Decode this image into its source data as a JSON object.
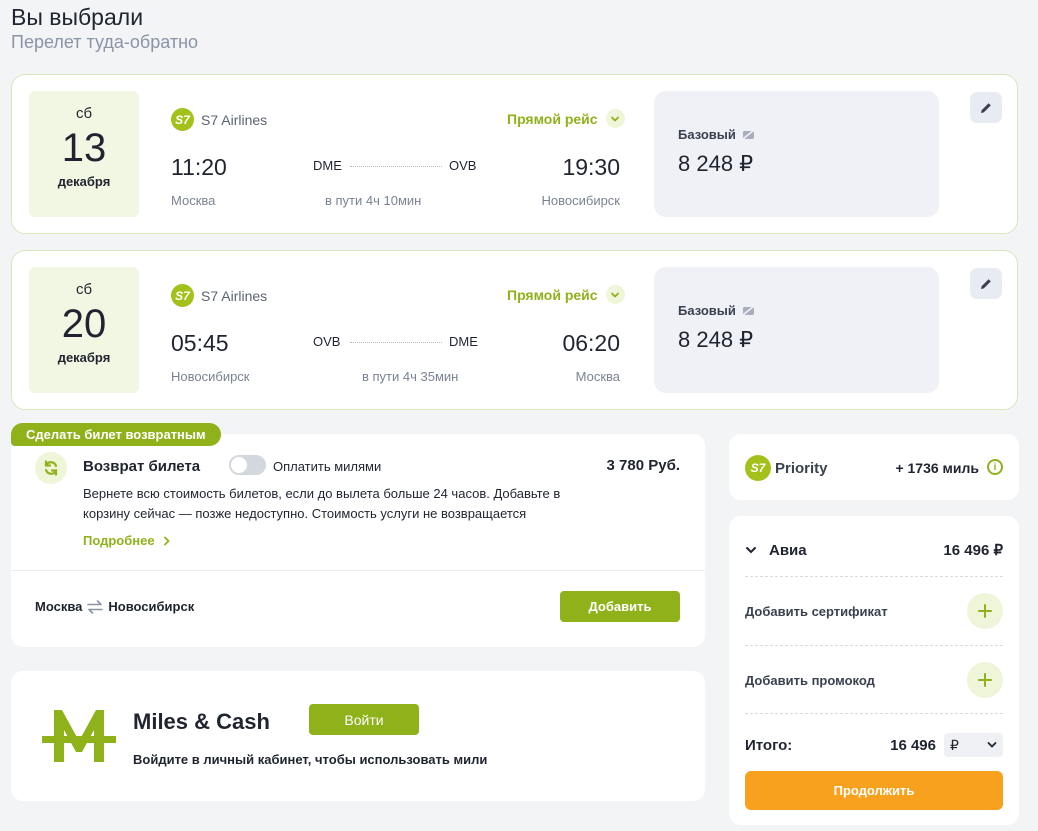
{
  "header": {
    "title": "Вы выбрали",
    "subtitle": "Перелет туда-обратно"
  },
  "flights": [
    {
      "weekday": "сб",
      "day": "13",
      "month": "декабря",
      "airline_logo": "S7",
      "airline": "S7 Airlines",
      "direct_label": "Прямой рейс",
      "dep_time": "11:20",
      "arr_time": "19:30",
      "from_code": "DME",
      "to_code": "OVB",
      "from_city": "Москва",
      "to_city": "Новосибирск",
      "duration": "в пути 4ч 10мин",
      "fare_name": "Базовый",
      "fare_price": "8 248 ₽"
    },
    {
      "weekday": "сб",
      "day": "20",
      "month": "декабря",
      "airline_logo": "S7",
      "airline": "S7 Airlines",
      "direct_label": "Прямой рейс",
      "dep_time": "05:45",
      "arr_time": "06:20",
      "from_code": "OVB",
      "to_code": "DME",
      "from_city": "Новосибирск",
      "to_city": "Москва",
      "duration": "в пути 4ч 35мин",
      "fare_name": "Базовый",
      "fare_price": "8 248 ₽"
    }
  ],
  "refund": {
    "tag": "Сделать билет возвратным",
    "title": "Возврат билета",
    "toggle_label": "Оплатить милями",
    "toggle_on": false,
    "price": "3 780 Руб.",
    "description": "Вернете всю стоимость билетов, если до вылета больше 24 часов. Добавьте в корзину сейчас — позже недоступно. Стоимость услуги не возвращается",
    "more_label": "Подробнее",
    "route_from": "Москва",
    "route_to": "Новосибирск",
    "add_label": "Добавить"
  },
  "miles_cash": {
    "title": "Miles & Cash",
    "login_label": "Войти",
    "subtitle": "Войдите в личный кабинет, чтобы использовать мили"
  },
  "priority": {
    "logo": "S7",
    "name": "Priority",
    "miles": "+ 1736 миль"
  },
  "summary": {
    "avia_label": "Авиа",
    "avia_sum": "16 496 ₽",
    "certificate_label": "Добавить сертификат",
    "promo_label": "Добавить промокод",
    "total_label": "Итого:",
    "total_sum": "16 496",
    "currency": "₽",
    "continue_label": "Продолжить"
  },
  "colors": {
    "accent_green": "#8fb21b",
    "accent_orange": "#f7a11e",
    "card_border": "#d9e6b8"
  }
}
